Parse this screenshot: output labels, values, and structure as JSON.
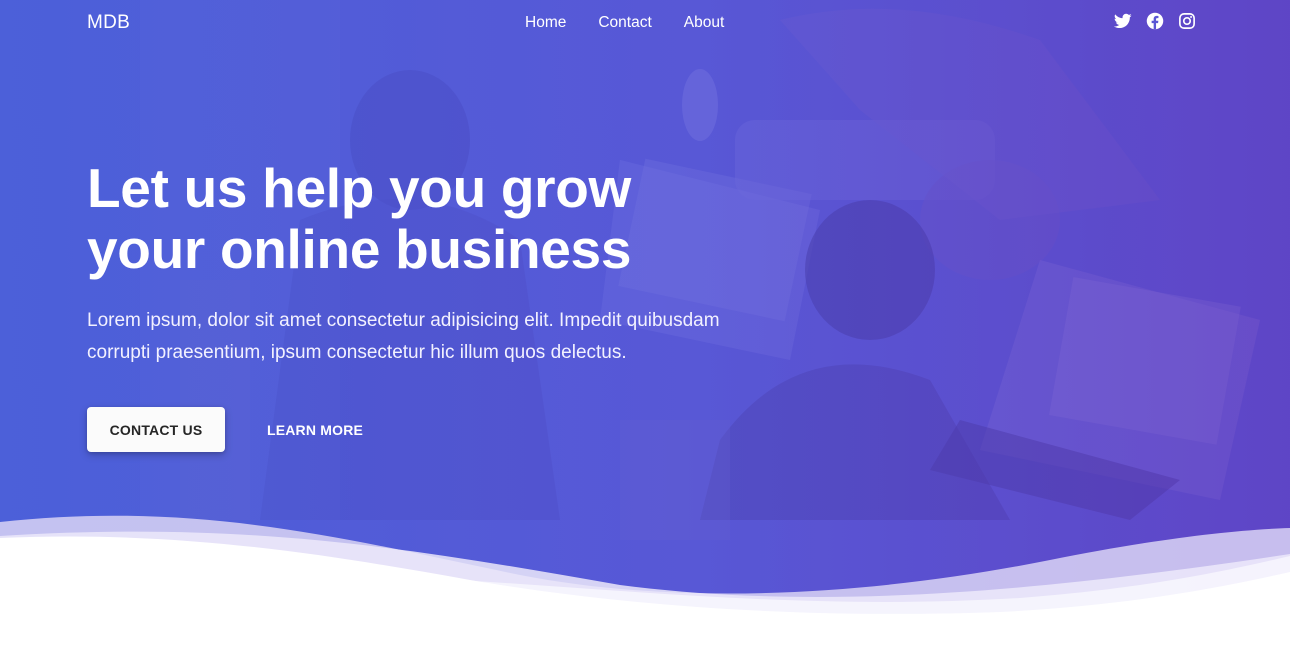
{
  "navbar": {
    "brand": "MDB",
    "links": [
      {
        "label": "Home"
      },
      {
        "label": "Contact"
      },
      {
        "label": "About"
      }
    ],
    "social": [
      {
        "icon": "twitter-icon"
      },
      {
        "icon": "facebook-icon"
      },
      {
        "icon": "instagram-icon"
      }
    ]
  },
  "hero": {
    "title_line1": "Let us help you grow",
    "title_line2": "your online business",
    "lead_line1": "Lorem ipsum, dolor sit amet consectetur adipisicing elit. Impedit quibusdam",
    "lead_line2": "corrupti praesentium, ipsum consectetur hic illum quos delectus.",
    "primary_button": "Contact us",
    "secondary_button": "Learn more"
  },
  "colors": {
    "gradient_left": "#4b62d6",
    "gradient_right": "#6240c0",
    "wave_light": "#d9d4f4",
    "text_white": "#ffffff"
  }
}
